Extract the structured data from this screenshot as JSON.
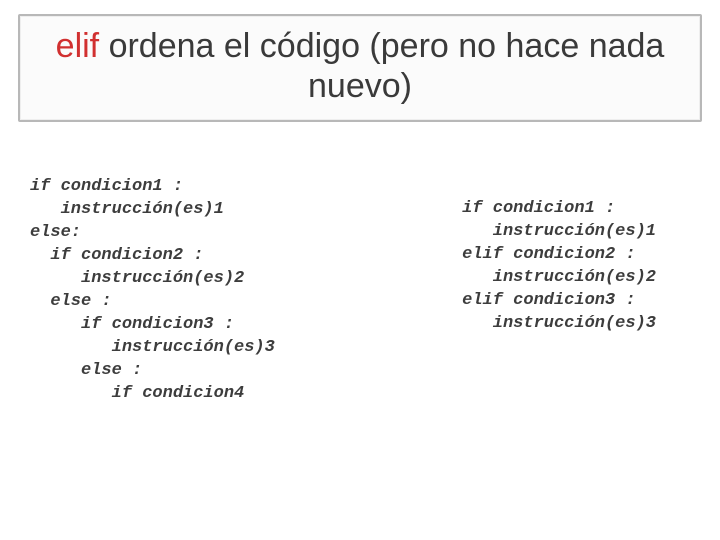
{
  "title": {
    "keyword": "elif",
    "rest": " ordena el código (pero no hace nada nuevo)"
  },
  "code_left": "if condicion1 :\n   instrucción(es)1\nelse:\n  if condicion2 :\n     instrucción(es)2\n  else :\n     if condicion3 :\n        instrucción(es)3\n     else :\n        if condicion4",
  "code_right": "if condicion1 :\n   instrucción(es)1\nelif condicion2 :\n   instrucción(es)2\nelif condicion3 :\n   instrucción(es)3"
}
